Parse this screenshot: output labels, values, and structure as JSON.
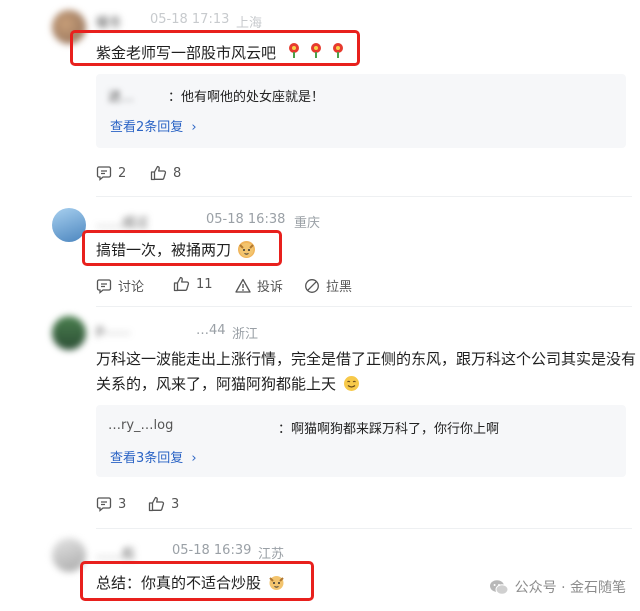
{
  "comments": [
    {
      "username": "暖冬",
      "date": "05-18 17:13",
      "location": "上海",
      "text": "紫金老师写一部股市风云吧",
      "reply": {
        "username": "进…",
        "text": "他有啊他的处女座就是！"
      },
      "more_replies": "查看2条回复",
      "likes_count": "2",
      "comment_count": "8"
    },
    {
      "username": "……成过",
      "date": "05-18 16:38",
      "location": "重庆",
      "text": "搞错一次，被捅两刀",
      "actions": {
        "discuss": "讨论",
        "likes": "11",
        "report": "投诉",
        "block": "拉黑"
      }
    },
    {
      "username": "p……",
      "date": "…44",
      "location": "浙江",
      "text_line1": "万科这一波能走出上涨行情，完全是借了正侧的东风，跟万科这个公司其实是没有",
      "text_line2": "关系的，风来了，阿猫阿狗都能上天",
      "reply": {
        "username": "…ry_…log",
        "text": "啊猫啊狗都来踩万科了，你行你上啊"
      },
      "more_replies": "查看3条回复",
      "likes_count": "3",
      "comment_count": "3"
    },
    {
      "username": "……彪",
      "date": "05-18 16:39",
      "location": "江苏",
      "text": "总结：你真的不适合炒股"
    }
  ],
  "watermark": {
    "label": "公众号 · 金石随笔"
  },
  "colors": {
    "highlight": "#e8201d",
    "link": "#2b64c5",
    "reply_bg": "#f6f7f9"
  }
}
